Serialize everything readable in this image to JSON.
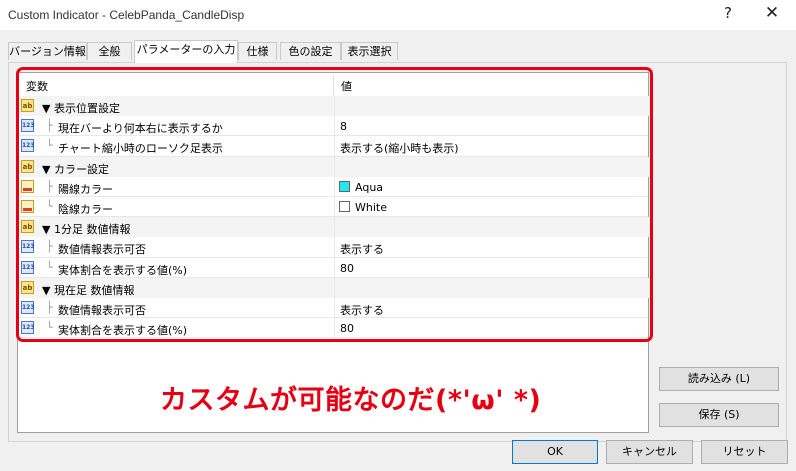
{
  "window": {
    "title": "Custom Indicator - CelebPanda_CandleDisp",
    "help_glyph": "?",
    "close_glyph": "✕"
  },
  "tabs": [
    {
      "label": "バージョン情報"
    },
    {
      "label": "全般"
    },
    {
      "label": "パラメーターの入力"
    },
    {
      "label": "仕様"
    },
    {
      "label": "色の設定"
    },
    {
      "label": "表示選択"
    }
  ],
  "table": {
    "col_variable": "変数",
    "col_value": "値",
    "rows": [
      {
        "icon": "ab",
        "name": "▼ 表示位置設定",
        "value": ""
      },
      {
        "icon": "123",
        "name": "現在バーより何本右に表示するか",
        "value": "8"
      },
      {
        "icon": "123",
        "name": "チャート縮小時のローソク足表示",
        "value": "表示する(縮小時も表示)"
      },
      {
        "icon": "ab",
        "name": "▼ カラー設定",
        "value": ""
      },
      {
        "icon": "color",
        "name": "陽線カラー",
        "value": "Aqua",
        "swatch": "#1ee8f0"
      },
      {
        "icon": "color",
        "name": "陰線カラー",
        "value": "White",
        "swatch": "#ffffff"
      },
      {
        "icon": "ab",
        "name": "▼ 1分足 数値情報",
        "value": ""
      },
      {
        "icon": "123",
        "name": "数値情報表示可否",
        "value": "表示する"
      },
      {
        "icon": "123",
        "name": "実体割合を表示する値(%)",
        "value": "80"
      },
      {
        "icon": "ab",
        "name": "▼ 現在足 数値情報",
        "value": ""
      },
      {
        "icon": "123",
        "name": "数値情報表示可否",
        "value": "表示する"
      },
      {
        "icon": "123",
        "name": "実体割合を表示する値(%)",
        "value": "80"
      }
    ]
  },
  "annotation": "カスタムが可能なのだ(*'ω' *)",
  "buttons": {
    "load": "読み込み (L)",
    "save": "保存 (S)",
    "ok": "OK",
    "cancel": "キャンセル",
    "reset": "リセット"
  },
  "colors": {
    "highlight": "#e60012",
    "aqua": "#1ee8f0",
    "white": "#ffffff"
  }
}
